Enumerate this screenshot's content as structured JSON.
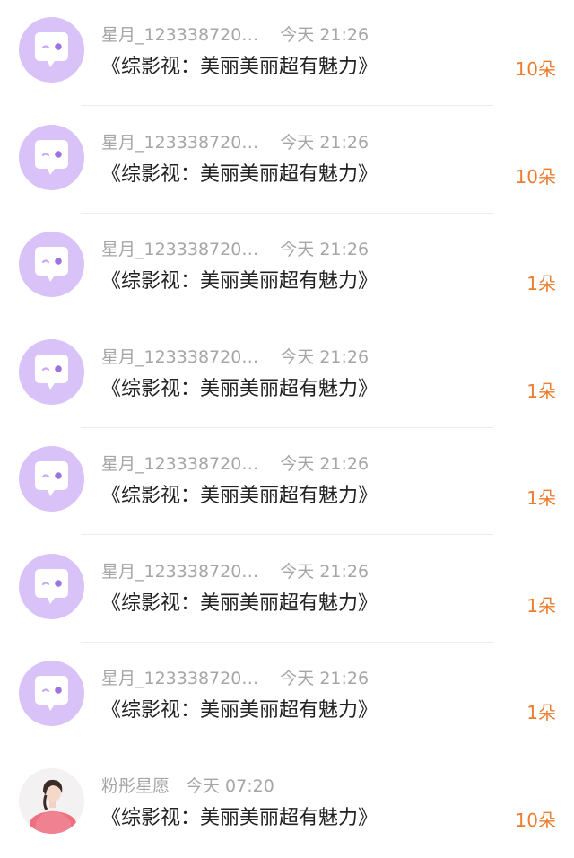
{
  "messages": [
    {
      "sender": "星月_123338720…",
      "time": "今天 21:26",
      "title": "《综影视：美丽美丽超有魅力》",
      "amount": "10朵",
      "avatar": "default-chat-bubble-icon"
    },
    {
      "sender": "星月_123338720…",
      "time": "今天 21:26",
      "title": "《综影视：美丽美丽超有魅力》",
      "amount": "10朵",
      "avatar": "default-chat-bubble-icon"
    },
    {
      "sender": "星月_123338720…",
      "time": "今天 21:26",
      "title": "《综影视：美丽美丽超有魅力》",
      "amount": "1朵",
      "avatar": "default-chat-bubble-icon"
    },
    {
      "sender": "星月_123338720…",
      "time": "今天 21:26",
      "title": "《综影视：美丽美丽超有魅力》",
      "amount": "1朵",
      "avatar": "default-chat-bubble-icon"
    },
    {
      "sender": "星月_123338720…",
      "time": "今天 21:26",
      "title": "《综影视：美丽美丽超有魅力》",
      "amount": "1朵",
      "avatar": "default-chat-bubble-icon"
    },
    {
      "sender": "星月_123338720…",
      "time": "今天 21:26",
      "title": "《综影视：美丽美丽超有魅力》",
      "amount": "1朵",
      "avatar": "default-chat-bubble-icon"
    },
    {
      "sender": "星月_123338720…",
      "time": "今天 21:26",
      "title": "《综影视：美丽美丽超有魅力》",
      "amount": "1朵",
      "avatar": "default-chat-bubble-icon"
    },
    {
      "sender": "粉彤星愿",
      "time": "今天 07:20",
      "title": "《综影视：美丽美丽超有魅力》",
      "amount": "10朵",
      "avatar": "user-photo-avatar"
    }
  ],
  "colors": {
    "amount": "#ee7c2e",
    "meta": "#a6a6a6",
    "title": "#222222",
    "avatar_bg": "#d9c2f7"
  }
}
